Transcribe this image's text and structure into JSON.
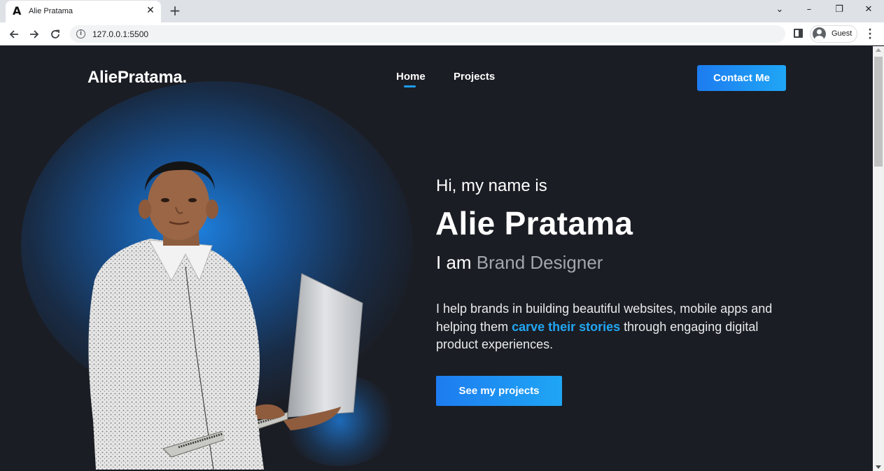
{
  "browser": {
    "tab": {
      "favicon": "A",
      "title": "Alie Pratama",
      "close": "✕"
    },
    "new_tab": "+",
    "window_controls": {
      "dropdown": "⌄",
      "minimize": "–",
      "restore": "❐",
      "close": "✕"
    },
    "url": "127.0.0.1:5500",
    "profile_label": "Guest",
    "menu": "⋮"
  },
  "site": {
    "logo": "AliePratama.",
    "nav": {
      "home": "Home",
      "projects": "Projects"
    },
    "contact_button": "Contact Me"
  },
  "hero": {
    "greeting": "Hi, my name is",
    "name": "Alie Pratama",
    "role_prefix": "I am ",
    "role": "Brand Designer",
    "desc_part1": "I help brands in building beautiful websites, mobile apps and helping them ",
    "desc_highlight": "carve their stories",
    "desc_part2": " through engaging digital product experiences.",
    "cta_button": "See my projects"
  },
  "colors": {
    "background": "#1b1d24",
    "accent": "#1e9bf0",
    "button_gradient_start": "#1d7cf0",
    "button_gradient_end": "#1fa6f5",
    "muted_text": "#a2a6ad"
  },
  "icons": [
    "back-arrow-icon",
    "forward-arrow-icon",
    "reload-icon",
    "info-icon",
    "side-panel-icon",
    "profile-avatar-icon",
    "kebab-menu-icon"
  ]
}
